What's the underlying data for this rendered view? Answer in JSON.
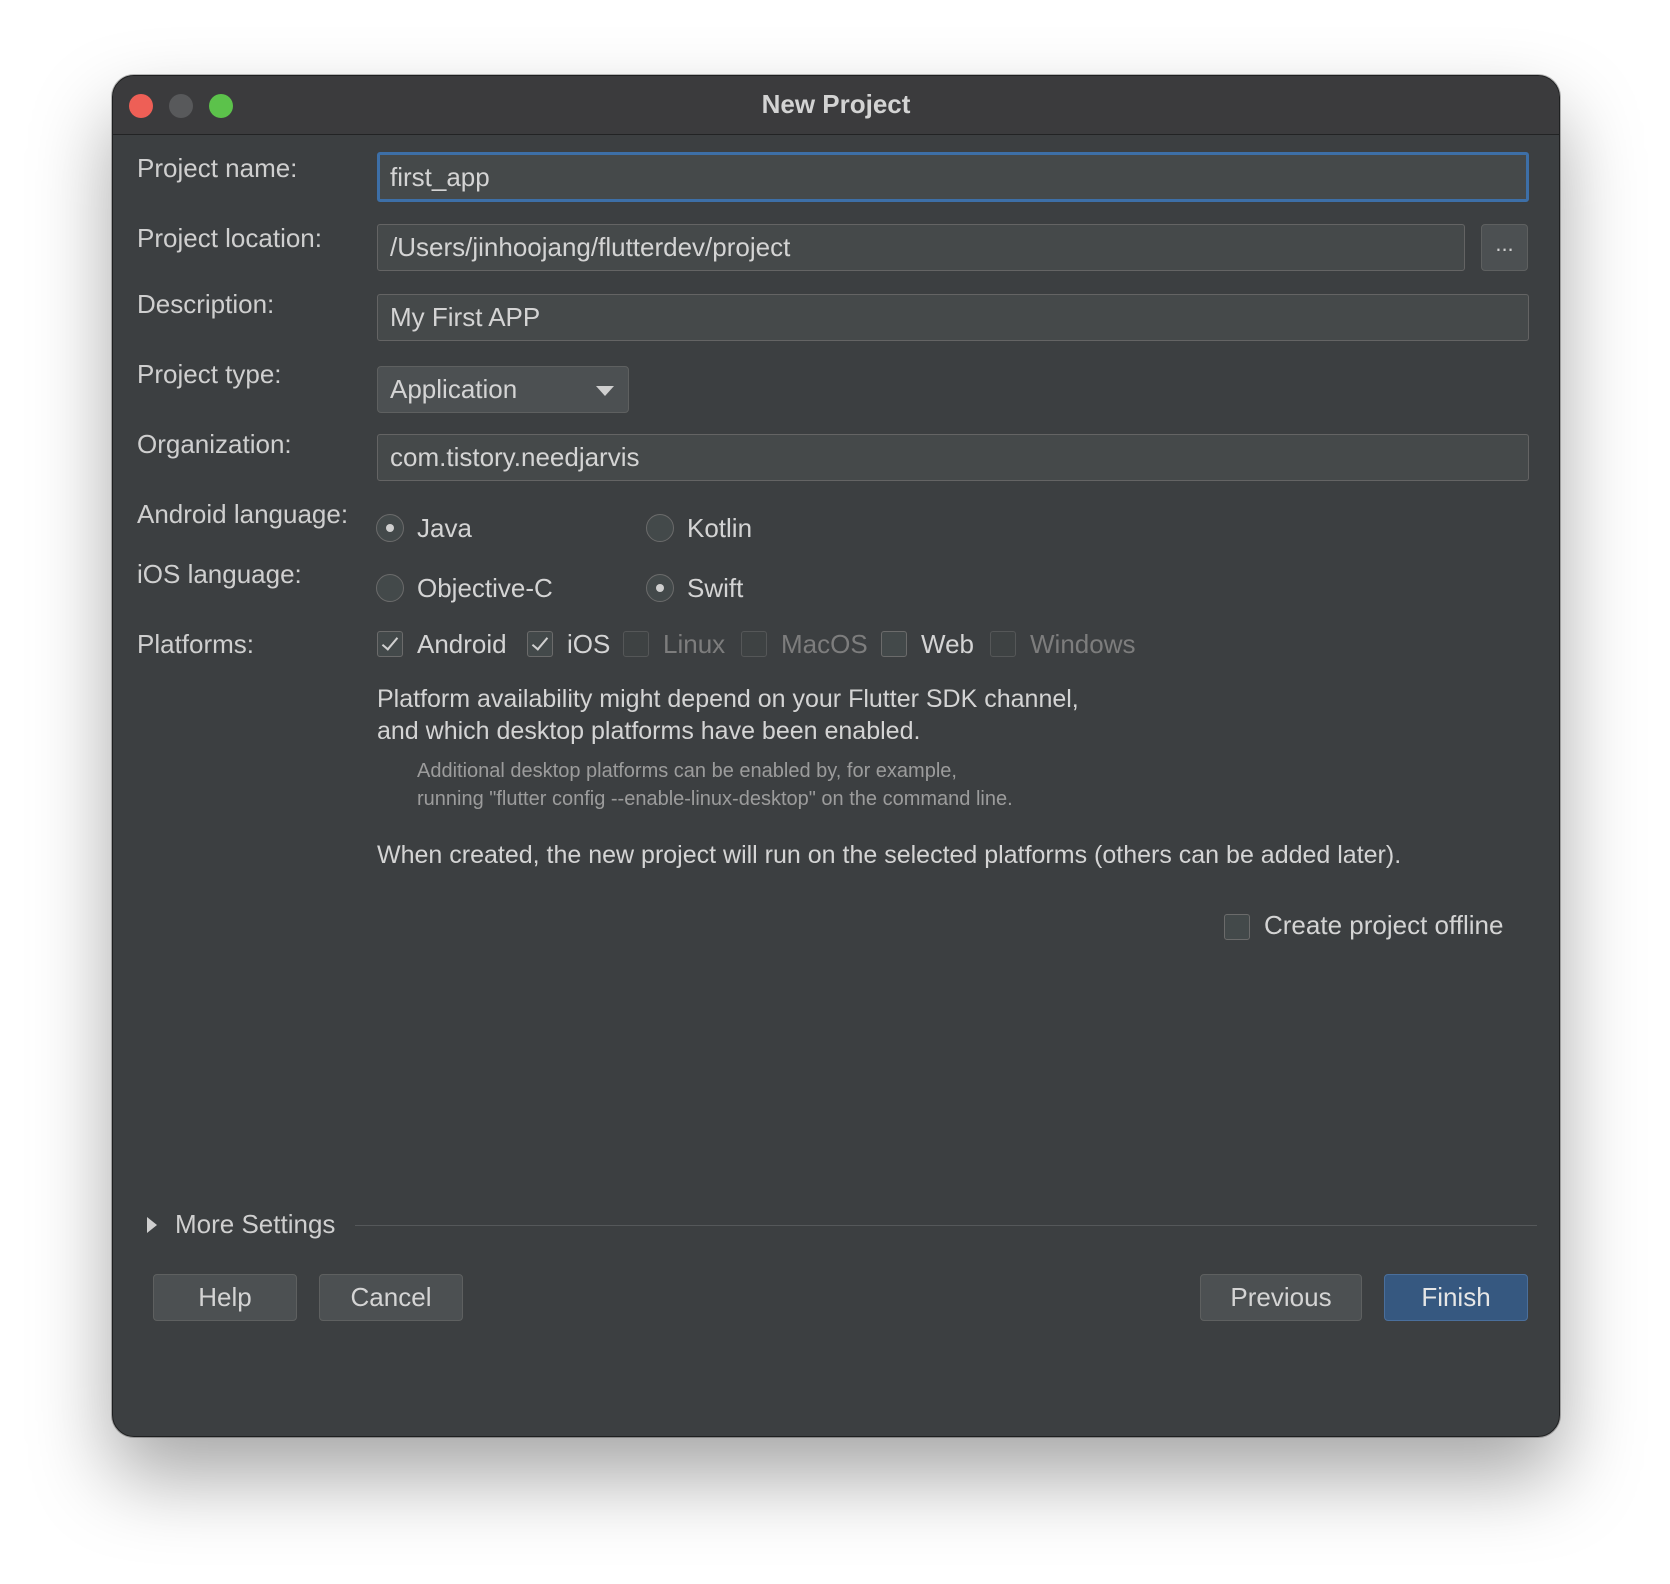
{
  "window": {
    "title": "New Project"
  },
  "form": {
    "project_name": {
      "label": "Project name:",
      "value": "first_app"
    },
    "project_location": {
      "label": "Project location:",
      "value": "/Users/jinhoojang/flutterdev/project",
      "browse_label": "..."
    },
    "description": {
      "label": "Description:",
      "value": "My First APP"
    },
    "project_type": {
      "label": "Project type:",
      "selected": "Application"
    },
    "organization": {
      "label": "Organization:",
      "value": "com.tistory.needjarvis"
    },
    "android_language": {
      "label": "Android language:",
      "options": [
        "Java",
        "Kotlin"
      ],
      "selected": "Java"
    },
    "ios_language": {
      "label": "iOS language:",
      "options": [
        "Objective-C",
        "Swift"
      ],
      "selected": "Swift"
    },
    "platforms": {
      "label": "Platforms:",
      "items": [
        {
          "name": "Android",
          "checked": true,
          "enabled": true
        },
        {
          "name": "iOS",
          "checked": true,
          "enabled": true
        },
        {
          "name": "Linux",
          "checked": false,
          "enabled": false
        },
        {
          "name": "MacOS",
          "checked": false,
          "enabled": false
        },
        {
          "name": "Web",
          "checked": false,
          "enabled": true
        },
        {
          "name": "Windows",
          "checked": false,
          "enabled": false
        }
      ]
    },
    "platform_note_line1": "Platform availability might depend on your Flutter SDK channel,",
    "platform_note_line2": "and which desktop platforms have been enabled.",
    "platform_subnote_line1": "Additional desktop platforms can be enabled by, for example,",
    "platform_subnote_line2": "running \"flutter config --enable-linux-desktop\" on the command line.",
    "created_note": "When created, the new project will run on the selected platforms (others can be added later).",
    "offline": {
      "label": "Create project offline",
      "checked": false
    }
  },
  "more_settings": {
    "label": "More Settings"
  },
  "buttons": {
    "help": "Help",
    "cancel": "Cancel",
    "previous": "Previous",
    "finish": "Finish"
  },
  "colors": {
    "window_bg": "#3c3f41",
    "focus_border": "#3d6fa7",
    "primary_button": "#365880"
  }
}
